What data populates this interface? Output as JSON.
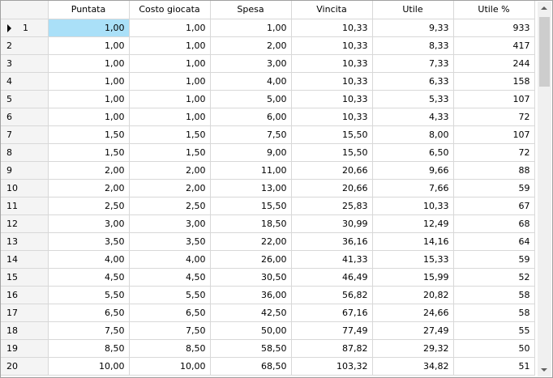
{
  "grid": {
    "columns": [
      "",
      "Puntata",
      "Costo giocata",
      "Spesa",
      "Vincita",
      "Utile",
      "Utile %"
    ],
    "current_row_index": 0,
    "selected_cell": {
      "row": 0,
      "column": 1
    },
    "rows": [
      {
        "num": "1",
        "cells": [
          "1,00",
          "1,00",
          "1,00",
          "10,33",
          "9,33",
          "933"
        ]
      },
      {
        "num": "2",
        "cells": [
          "1,00",
          "1,00",
          "2,00",
          "10,33",
          "8,33",
          "417"
        ]
      },
      {
        "num": "3",
        "cells": [
          "1,00",
          "1,00",
          "3,00",
          "10,33",
          "7,33",
          "244"
        ]
      },
      {
        "num": "4",
        "cells": [
          "1,00",
          "1,00",
          "4,00",
          "10,33",
          "6,33",
          "158"
        ]
      },
      {
        "num": "5",
        "cells": [
          "1,00",
          "1,00",
          "5,00",
          "10,33",
          "5,33",
          "107"
        ]
      },
      {
        "num": "6",
        "cells": [
          "1,00",
          "1,00",
          "6,00",
          "10,33",
          "4,33",
          "72"
        ]
      },
      {
        "num": "7",
        "cells": [
          "1,50",
          "1,50",
          "7,50",
          "15,50",
          "8,00",
          "107"
        ]
      },
      {
        "num": "8",
        "cells": [
          "1,50",
          "1,50",
          "9,00",
          "15,50",
          "6,50",
          "72"
        ]
      },
      {
        "num": "9",
        "cells": [
          "2,00",
          "2,00",
          "11,00",
          "20,66",
          "9,66",
          "88"
        ]
      },
      {
        "num": "10",
        "cells": [
          "2,00",
          "2,00",
          "13,00",
          "20,66",
          "7,66",
          "59"
        ]
      },
      {
        "num": "11",
        "cells": [
          "2,50",
          "2,50",
          "15,50",
          "25,83",
          "10,33",
          "67"
        ]
      },
      {
        "num": "12",
        "cells": [
          "3,00",
          "3,00",
          "18,50",
          "30,99",
          "12,49",
          "68"
        ]
      },
      {
        "num": "13",
        "cells": [
          "3,50",
          "3,50",
          "22,00",
          "36,16",
          "14,16",
          "64"
        ]
      },
      {
        "num": "14",
        "cells": [
          "4,00",
          "4,00",
          "26,00",
          "41,33",
          "15,33",
          "59"
        ]
      },
      {
        "num": "15",
        "cells": [
          "4,50",
          "4,50",
          "30,50",
          "46,49",
          "15,99",
          "52"
        ]
      },
      {
        "num": "16",
        "cells": [
          "5,50",
          "5,50",
          "36,00",
          "56,82",
          "20,82",
          "58"
        ]
      },
      {
        "num": "17",
        "cells": [
          "6,50",
          "6,50",
          "42,50",
          "67,16",
          "24,66",
          "58"
        ]
      },
      {
        "num": "18",
        "cells": [
          "7,50",
          "7,50",
          "50,00",
          "77,49",
          "27,49",
          "55"
        ]
      },
      {
        "num": "19",
        "cells": [
          "8,50",
          "8,50",
          "58,50",
          "87,82",
          "29,32",
          "50"
        ]
      },
      {
        "num": "20",
        "cells": [
          "10,00",
          "10,00",
          "68,50",
          "103,32",
          "34,82",
          "51"
        ]
      }
    ]
  },
  "icons": {
    "row_indicator": "current-row-arrow-icon",
    "scroll_up": "chevron-up-icon",
    "scroll_down": "chevron-down-icon"
  }
}
